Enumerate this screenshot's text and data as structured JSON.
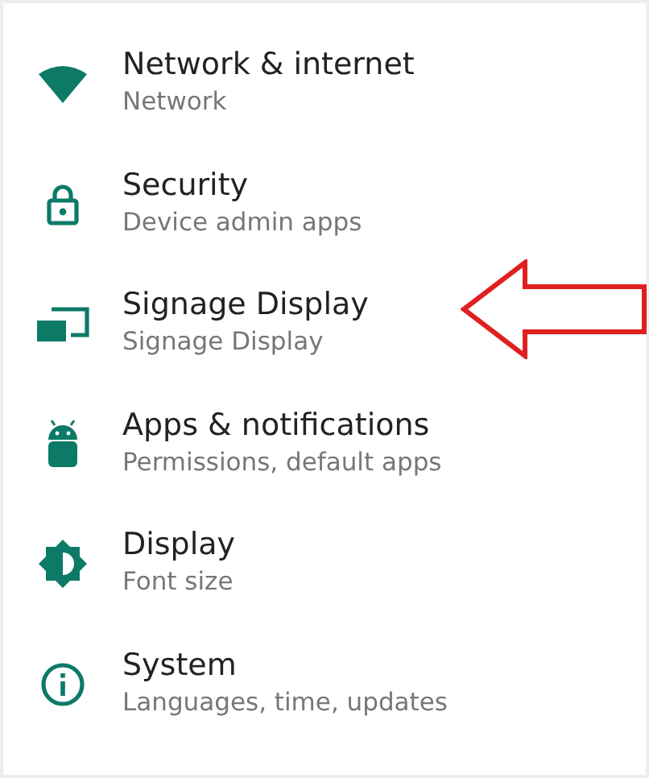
{
  "settings": [
    {
      "kind": "wifi",
      "title": "Network & internet",
      "subtitle": "Network",
      "highlighted": false
    },
    {
      "kind": "lock",
      "title": "Security",
      "subtitle": "Device admin apps",
      "highlighted": false
    },
    {
      "kind": "screens",
      "title": "Signage Display",
      "subtitle": "Signage Display",
      "highlighted": true
    },
    {
      "kind": "android",
      "title": "Apps & notifications",
      "subtitle": "Permissions, default apps",
      "highlighted": false
    },
    {
      "kind": "brightness",
      "title": "Display",
      "subtitle": "Font size",
      "highlighted": false
    },
    {
      "kind": "info",
      "title": "System",
      "subtitle": "Languages, time, updates",
      "highlighted": false
    }
  ]
}
